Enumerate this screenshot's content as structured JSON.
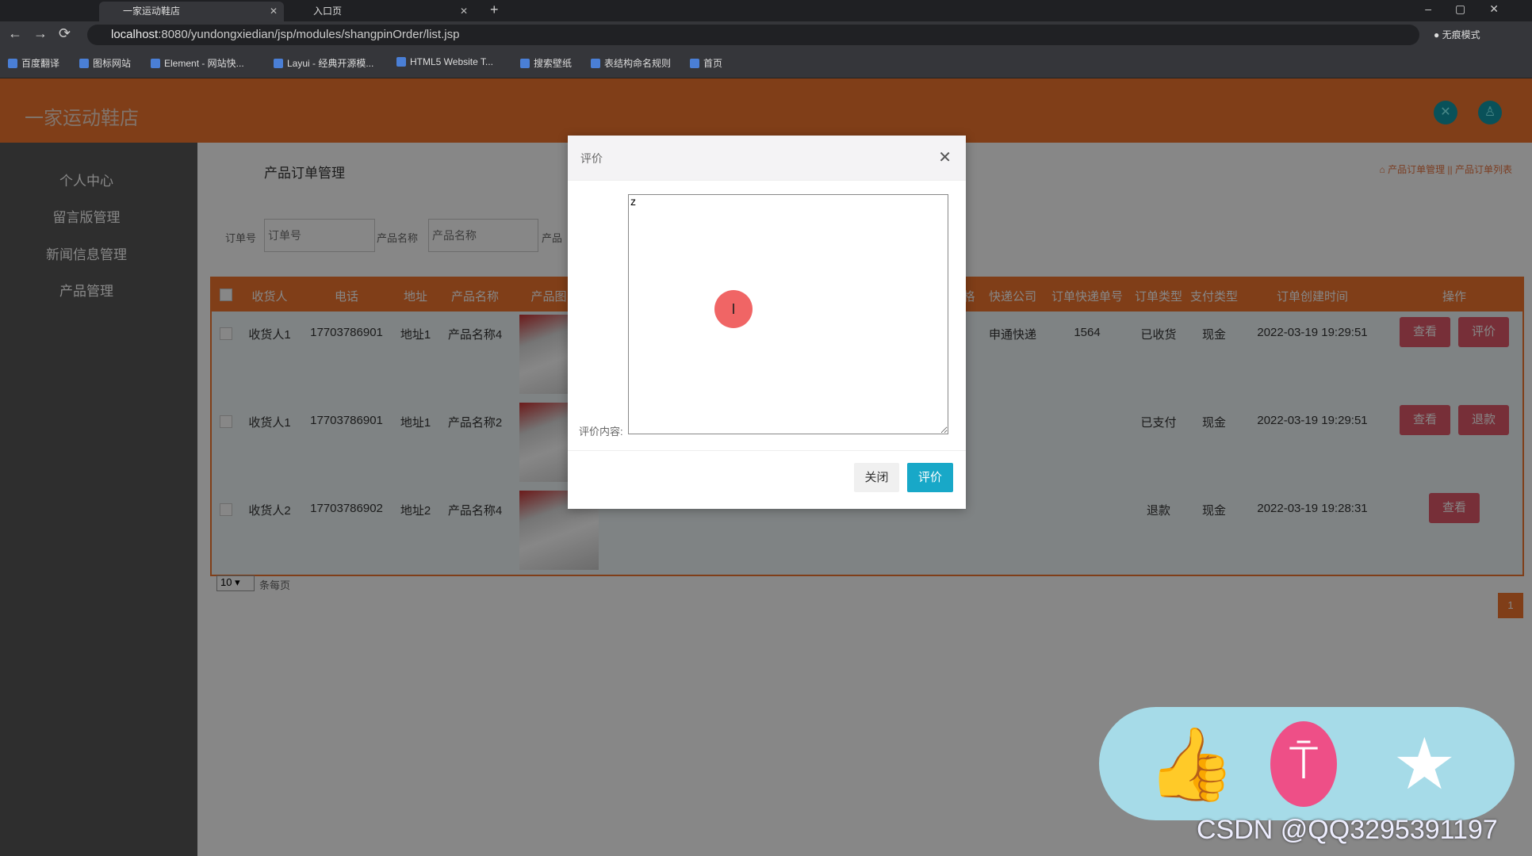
{
  "browser": {
    "tabs": [
      {
        "label": "一家运动鞋店",
        "active": true
      },
      {
        "label": "入口页",
        "active": false
      }
    ],
    "url_host": "localhost",
    "url_rest": ":8080/yundongxiedian/jsp/modules/shangpinOrder/list.jsp",
    "profile": "无痕模式",
    "bookmarks": [
      "百度翻译",
      "图标网站",
      "Element - 网站快...",
      "Layui - 经典开源模...",
      "HTML5 Website T...",
      "搜索壁纸",
      "表结构命名规则",
      "首页"
    ]
  },
  "header": {
    "logo": "一家运动鞋店",
    "icons": [
      "fullscreen-icon",
      "user-icon"
    ]
  },
  "sidebar": {
    "items": [
      "个人中心",
      "留言版管理",
      "新闻信息管理",
      "产品管理"
    ]
  },
  "main": {
    "title": "产品订单管理",
    "breadcrumb": "产品订单管理 || 产品订单列表",
    "search": [
      {
        "label": "订单号",
        "placeholder": "订单号"
      },
      {
        "label": "产品名称",
        "placeholder": "产品名称"
      },
      {
        "label": "产品"
      }
    ],
    "columns": [
      "收货人",
      "电话",
      "地址",
      "产品名称",
      "产品图",
      "格",
      "快递公司",
      "订单快递单号",
      "订单类型",
      "支付类型",
      "订单创建时间",
      "操作"
    ],
    "rows": [
      {
        "receiver": "收货人1",
        "phone": "17703786901",
        "address": "地址1",
        "product": "产品名称4",
        "express": "申通快递",
        "tracking": "1564",
        "type": "已收货",
        "pay": "现金",
        "created": "2022-03-19 19:29:51",
        "actions": [
          "查看",
          "评价"
        ]
      },
      {
        "receiver": "收货人1",
        "phone": "17703786901",
        "address": "地址1",
        "product": "产品名称2",
        "express": "",
        "tracking": "",
        "type": "已支付",
        "pay": "现金",
        "created": "2022-03-19 19:29:51",
        "actions": [
          "查看",
          "退款"
        ]
      },
      {
        "receiver": "收货人2",
        "phone": "17703786902",
        "address": "地址2",
        "product": "产品名称4",
        "express": "",
        "tracking": "",
        "type": "退款",
        "pay": "现金",
        "created": "2022-03-19 19:28:31",
        "actions": [
          "查看"
        ]
      }
    ],
    "page_size": "10",
    "page_size_label": "条每页",
    "current_page": "1"
  },
  "modal": {
    "title": "评价",
    "field_label": "评价内容:",
    "textarea_value": "z",
    "close_label": "关闭",
    "submit_label": "评价"
  },
  "overlay_widget": {
    "icons": [
      "thumbs-up-icon",
      "pin-icon",
      "star-icon"
    ],
    "watermark": "CSDN @QQ3295391197"
  },
  "colors": {
    "accent": "#f1752f",
    "submit": "#18a8c8",
    "action": "#e05a6a"
  }
}
